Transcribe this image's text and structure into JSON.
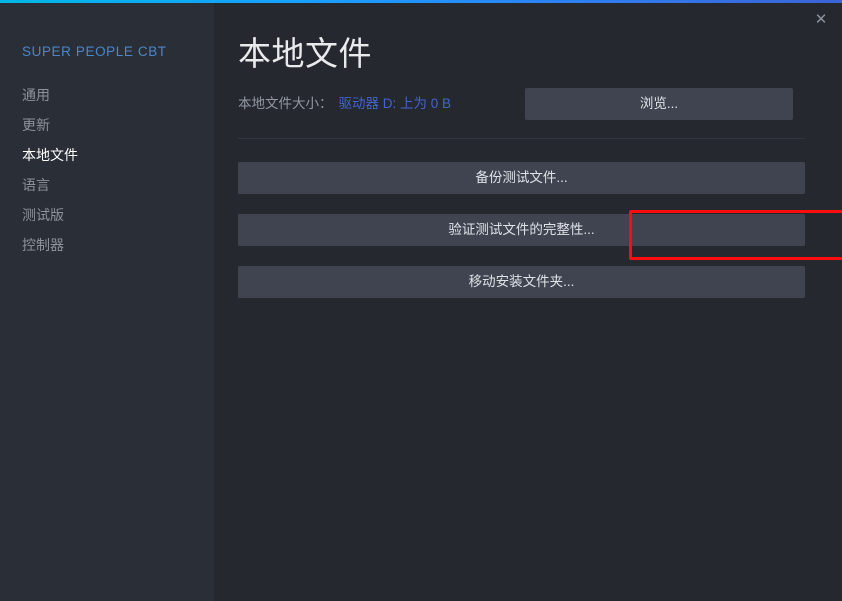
{
  "window": {
    "close_label": "✕",
    "accent_color": "#1a9fff"
  },
  "sidebar": {
    "title": "SUPER PEOPLE CBT",
    "items": [
      {
        "label": "通用",
        "active": false
      },
      {
        "label": "更新",
        "active": false
      },
      {
        "label": "本地文件",
        "active": true
      },
      {
        "label": "语言",
        "active": false
      },
      {
        "label": "测试版",
        "active": false
      },
      {
        "label": "控制器",
        "active": false
      }
    ]
  },
  "main": {
    "page_title": "本地文件",
    "size_label": "本地文件大小：",
    "size_value": "驱动器 D: 上为 0 B",
    "size_value_color": "#4464cf",
    "browse_button": "浏览...",
    "actions": [
      {
        "label": "备份测试文件..."
      },
      {
        "label": "验证测试文件的完整性..."
      },
      {
        "label": "移动安装文件夹..."
      }
    ],
    "highlight": {
      "target": "验证测试文件的完整性...",
      "color": "#fb0d0d"
    }
  }
}
